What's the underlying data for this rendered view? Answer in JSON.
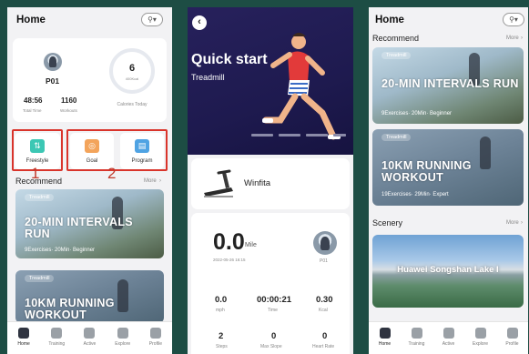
{
  "home": {
    "title": "Home",
    "header_icon": "bike-icon",
    "device": "P01",
    "stats": [
      {
        "value": "48:56",
        "label": "Total Time"
      },
      {
        "value": "1160",
        "label": "Workouts"
      }
    ],
    "calorie_ring": {
      "value": "6",
      "unit": "400Kcal",
      "label": "Calories Today"
    },
    "modes": [
      {
        "label": "Freestyle",
        "icon": "freestyle-icon",
        "color": "#3cc7b4"
      },
      {
        "label": "Goal",
        "icon": "goal-icon",
        "color": "#f3a45b"
      },
      {
        "label": "Program",
        "icon": "program-icon",
        "color": "#4fa3e3"
      }
    ],
    "annotations": [
      "1",
      "2"
    ],
    "recommend": {
      "title": "Recommend",
      "more": "More",
      "items": [
        {
          "tag": "Treadmill",
          "title": "20-MIN INTERVALS RUN",
          "sub": "9Exercises· 20Min· Beginner"
        },
        {
          "tag": "Treadmill",
          "title": "10KM RUNNING WORKOUT",
          "sub": ""
        }
      ]
    }
  },
  "tabs": [
    {
      "label": "Home",
      "icon": "home-icon"
    },
    {
      "label": "Training",
      "icon": "training-icon"
    },
    {
      "label": "Active",
      "icon": "active-icon"
    },
    {
      "label": "Explore",
      "icon": "explore-icon"
    },
    {
      "label": "Profile",
      "icon": "profile-icon"
    }
  ],
  "quickstart": {
    "title": "Quick start",
    "subtitle": "Treadmill",
    "back_icon": "chevron-left-icon",
    "device_name": "Winfita",
    "distance": {
      "value": "0.0",
      "unit": "Mile"
    },
    "date": "2022-05-26 16:15",
    "device": "P01",
    "metrics": [
      {
        "value": "0.0",
        "label": "mph"
      },
      {
        "value": "00:00:21",
        "label": "Time"
      },
      {
        "value": "0.30",
        "label": "Kcal"
      },
      {
        "value": "2",
        "label": "Steps"
      },
      {
        "value": "0",
        "label": "Max Slope"
      },
      {
        "value": "0",
        "label": "Heart Rate"
      }
    ]
  },
  "home2": {
    "title": "Home",
    "recommend": {
      "title": "Recommend",
      "more": "More",
      "items": [
        {
          "tag": "Treadmill",
          "title": "20-MIN INTERVALS RUN",
          "sub": "9Exercises· 20Min· Beginner"
        },
        {
          "tag": "Treadmill",
          "title": "10KM RUNNING WORKOUT",
          "sub": "19Exercises· 29Min· Expert"
        }
      ]
    },
    "scenery": {
      "title": "Scenery",
      "more": "More",
      "label": "Huawei Songshan Lake I"
    }
  }
}
